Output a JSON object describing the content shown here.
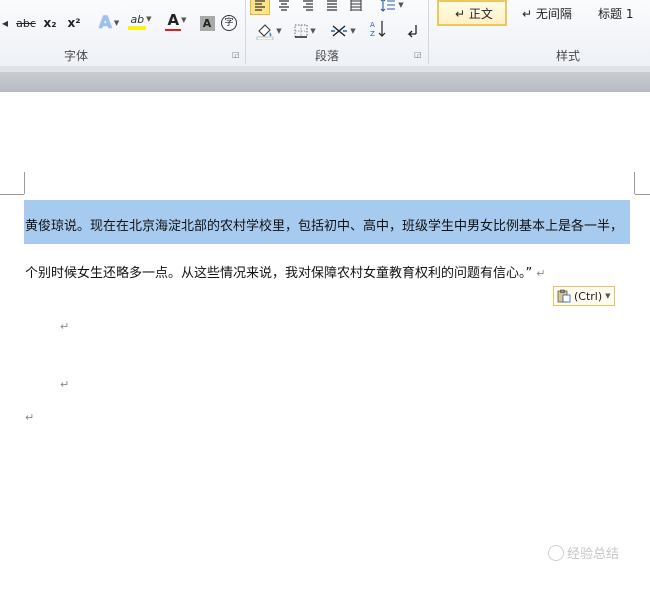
{
  "ribbon": {
    "font_group": {
      "label": "字体",
      "strike_label": "abc",
      "subscript_label": "x₂",
      "superscript_label": "x²",
      "effects_label": "A",
      "highlight_label": "ab",
      "font_color_label": "A",
      "shading_label": "A",
      "enclose_label": "字",
      "highlight_color": "#f7f11c",
      "font_color": "#d92020"
    },
    "paragraph_group": {
      "label": "段落"
    },
    "styles_group": {
      "label": "样式",
      "items": [
        {
          "label": "↵ 正文",
          "selected": true
        },
        {
          "label": "↵ 无间隔",
          "selected": false
        },
        {
          "label": "标题 1",
          "selected": false
        }
      ]
    }
  },
  "document": {
    "line1": "黄俊琼说。现在在北京海淀北部的农村学校里，包括初中、高中，班级学生中男女比例基本上是各一半，",
    "line2": "个别时候女生还略多一点。从这些情况来说，我对保障农村女童教育权利的问题有信心。”",
    "paragraph_mark": "↵",
    "selection_color": "#a7cbef"
  },
  "paste_options": {
    "label": "(Ctrl)"
  },
  "watermark": {
    "text": "经验总结"
  }
}
